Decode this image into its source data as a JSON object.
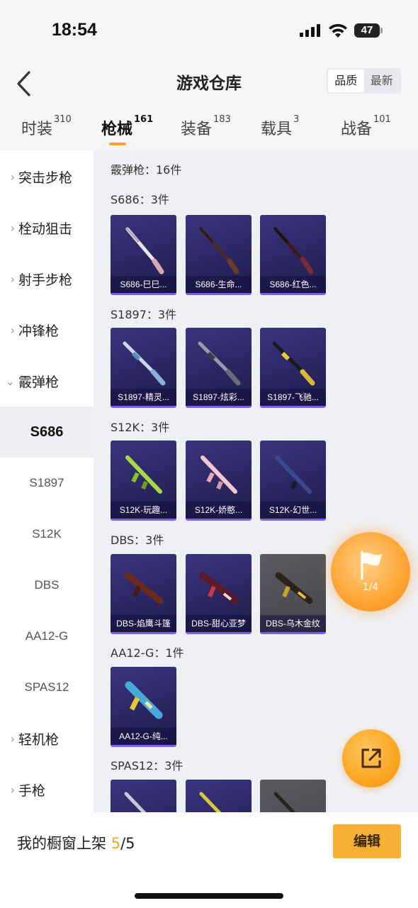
{
  "status_bar": {
    "time": "18:54",
    "battery": "47"
  },
  "nav": {
    "title": "游戏仓库",
    "sort_options": [
      "品质",
      "最新"
    ],
    "active_sort": "品质"
  },
  "category_tabs": [
    {
      "label": "时装",
      "count": "310"
    },
    {
      "label": "枪械",
      "count": "161"
    },
    {
      "label": "装备",
      "count": "183"
    },
    {
      "label": "载具",
      "count": "3"
    },
    {
      "label": "战备",
      "count": "101"
    }
  ],
  "sidebar": {
    "items": [
      {
        "label": "突击步枪"
      },
      {
        "label": "栓动狙击"
      },
      {
        "label": "射手步枪"
      },
      {
        "label": "冲锋枪"
      },
      {
        "label": "霰弹枪"
      }
    ],
    "sub_items": [
      {
        "label": "S686"
      },
      {
        "label": "S1897"
      },
      {
        "label": "S12K"
      },
      {
        "label": "DBS"
      },
      {
        "label": "AA12-G"
      },
      {
        "label": "SPAS12"
      }
    ],
    "more_items": [
      {
        "label": "轻机枪"
      },
      {
        "label": "手枪"
      }
    ]
  },
  "content": {
    "category_header": "霰弹枪：16件",
    "groups": [
      {
        "title": "S686：3件",
        "items": [
          "S686-巳巳...",
          "S686-生命...",
          "S686-红色..."
        ]
      },
      {
        "title": "S1897：3件",
        "items": [
          "S1897-精灵...",
          "S1897-炫彩...",
          "S1897-飞驰..."
        ]
      },
      {
        "title": "S12K：3件",
        "items": [
          "S12K-玩趣...",
          "S12K-娇憨...",
          "S12K-幻世..."
        ]
      },
      {
        "title": "DBS：3件",
        "items": [
          "DBS-焰鹰斗篷",
          "DBS-甜心亚梦",
          "DBS-乌木金纹"
        ]
      },
      {
        "title": "AA12-G：1件",
        "items": [
          "AA12-G-纯..."
        ]
      },
      {
        "title": "SPAS12：3件",
        "items": []
      }
    ]
  },
  "floating": {
    "flag_count": "1/4"
  },
  "bottom_bar": {
    "showcase_label": "我的橱窗上架",
    "current": "5",
    "total": "/5",
    "edit_label": "编辑"
  },
  "colors": {
    "accent": "#f5a623",
    "card_purple": "#2e2868",
    "card_border": "#7b5cff"
  }
}
